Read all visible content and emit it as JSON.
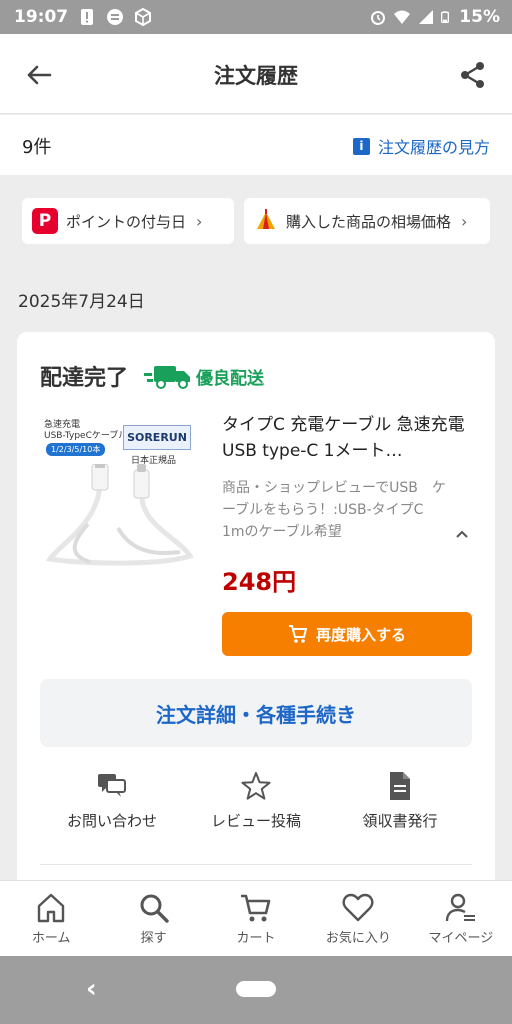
{
  "status_bar": {
    "time": "19:07",
    "battery": "15%"
  },
  "header": {
    "title": "注文履歴"
  },
  "count": {
    "label": "9件",
    "guide_link": "注文履歴の見方"
  },
  "pills": [
    {
      "label": "ポイントの付与日"
    },
    {
      "label": "購入した商品の相場価格"
    }
  ],
  "order": {
    "date": "2025年7月24日",
    "status": "配達完了",
    "shipping_badge": "優良配送",
    "product": {
      "title": "タイプC 充電ケーブル 急速充電 USB type-C 1メート…",
      "review_note": "商品・ショップレビューでUSB　ケーブルをもらう！:USB-タイプC　1mのケーブル希望",
      "price": "248円",
      "image_text": {
        "line1": "急速充電",
        "line2": "USB-TypeCケーブル",
        "lengths": "1/2/3/5/10本",
        "brand": "SORERUN",
        "genuine": "日本正規品"
      }
    },
    "rebuy_label": "再度購入する",
    "detail_label": "注文詳細・各種手続き",
    "actions": [
      {
        "label": "お問い合わせ",
        "icon": "chat-icon"
      },
      {
        "label": "レビュー投稿",
        "icon": "star-icon"
      },
      {
        "label": "領収書発行",
        "icon": "document-icon"
      }
    ]
  },
  "bottom_nav": [
    {
      "label": "ホーム",
      "icon": "home-icon"
    },
    {
      "label": "探す",
      "icon": "search-icon"
    },
    {
      "label": "カート",
      "icon": "cart-icon"
    },
    {
      "label": "お気に入り",
      "icon": "heart-icon"
    },
    {
      "label": "マイページ",
      "icon": "person-icon"
    }
  ],
  "colors": {
    "link_blue": "#1c67c7",
    "price_red": "#bf0000",
    "rebuy_orange": "#f77f00",
    "shipping_green": "#19a05a",
    "paypay_red": "#e6002d"
  }
}
